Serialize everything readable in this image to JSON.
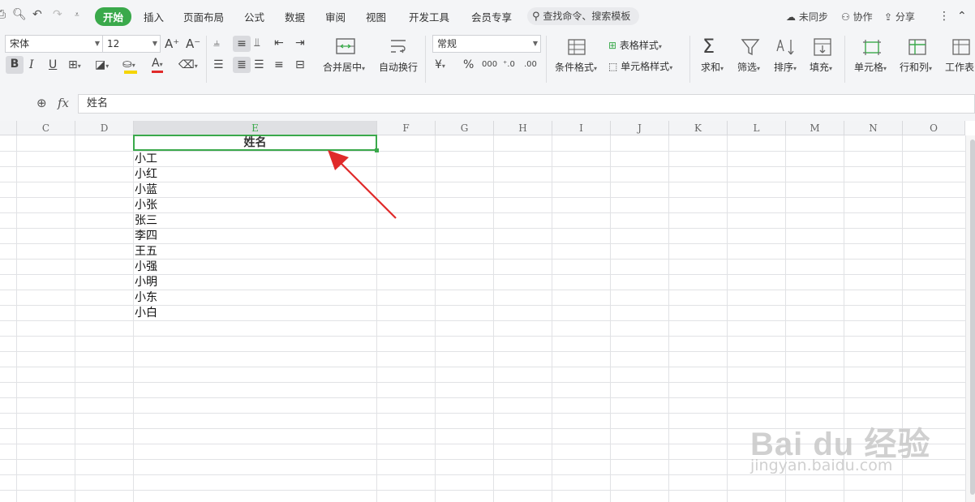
{
  "menubar": {
    "tabs": [
      {
        "label": "开始",
        "active": true
      },
      {
        "label": "插入"
      },
      {
        "label": "页面布局"
      },
      {
        "label": "公式"
      },
      {
        "label": "数据"
      },
      {
        "label": "审阅"
      },
      {
        "label": "视图"
      },
      {
        "label": "开发工具"
      },
      {
        "label": "会员专享"
      }
    ],
    "search_label": "查找命令、搜索模板",
    "sync_label": "未同步",
    "collab_label": "协作",
    "share_label": "分享"
  },
  "ribbon": {
    "font_name": "宋体",
    "font_size": "12",
    "number_format": "常规",
    "merge_label": "合并居中",
    "wrap_label": "自动换行",
    "cond_format_label": "条件格式",
    "table_style_label": "表格样式",
    "cell_style_label": "单元格样式",
    "sum_label": "求和",
    "filter_label": "筛选",
    "sort_label": "排序",
    "fill_label": "填充",
    "cell_label": "单元格",
    "rowcol_label": "行和列",
    "worksheet_label": "工作表"
  },
  "formula_bar": {
    "fx_label": "fx",
    "value": "姓名"
  },
  "grid": {
    "columns": [
      "C",
      "D",
      "E",
      "F",
      "G",
      "H",
      "I",
      "J",
      "K",
      "L",
      "M",
      "N",
      "O"
    ],
    "selected_column": "E",
    "header_cell": "姓名",
    "names": [
      "小工",
      "小红",
      "小蓝",
      "小张",
      "张三",
      "李四",
      "王五",
      "小强",
      "小明",
      "小东",
      "小白"
    ]
  },
  "watermark": {
    "brand": "Bai du 经验",
    "url": "jingyan.baidu.com"
  },
  "colors": {
    "accent": "#3aa94b",
    "arrow": "#e02a2a",
    "font_color_bar": "#e02a2a",
    "fill_color_bar": "#f5d500"
  }
}
